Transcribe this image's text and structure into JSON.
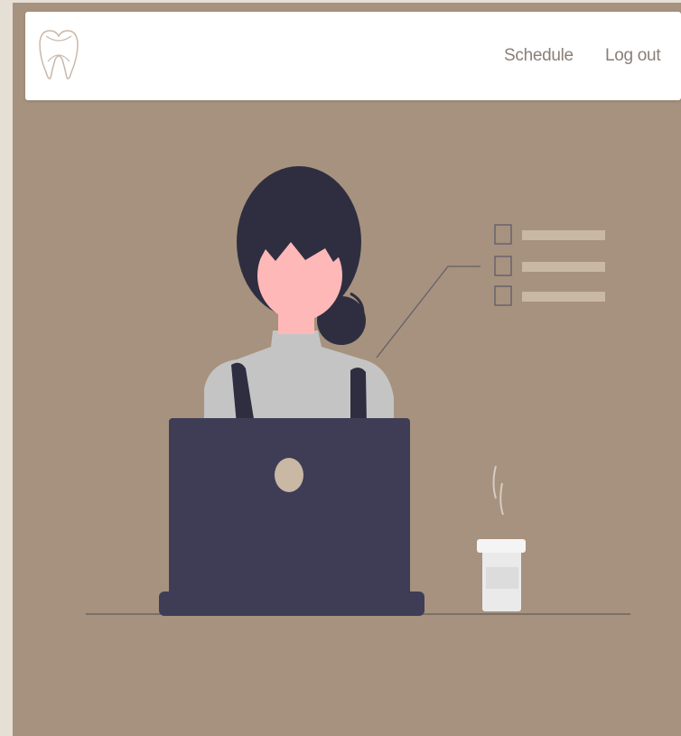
{
  "nav": {
    "logo_icon": "tooth-logo-icon",
    "links": [
      {
        "label": "Schedule",
        "icon": null
      },
      {
        "label": "Log out",
        "icon": null
      }
    ]
  },
  "colors": {
    "page_background": "#e6dfd6",
    "panel_background": "#a6927e",
    "navbar_background": "#ffffff",
    "nav_link_text": "#8a7f78",
    "laptop": "#3f3d56",
    "hair": "#2f2e41",
    "skin": "#ffb8b8",
    "shirt": "#c4c4c4",
    "checklist_bar": "#c8b8a4",
    "cup": "#eaeaea"
  },
  "illustration": {
    "name": "woman-at-laptop-illustration",
    "checklist_items": 3
  }
}
